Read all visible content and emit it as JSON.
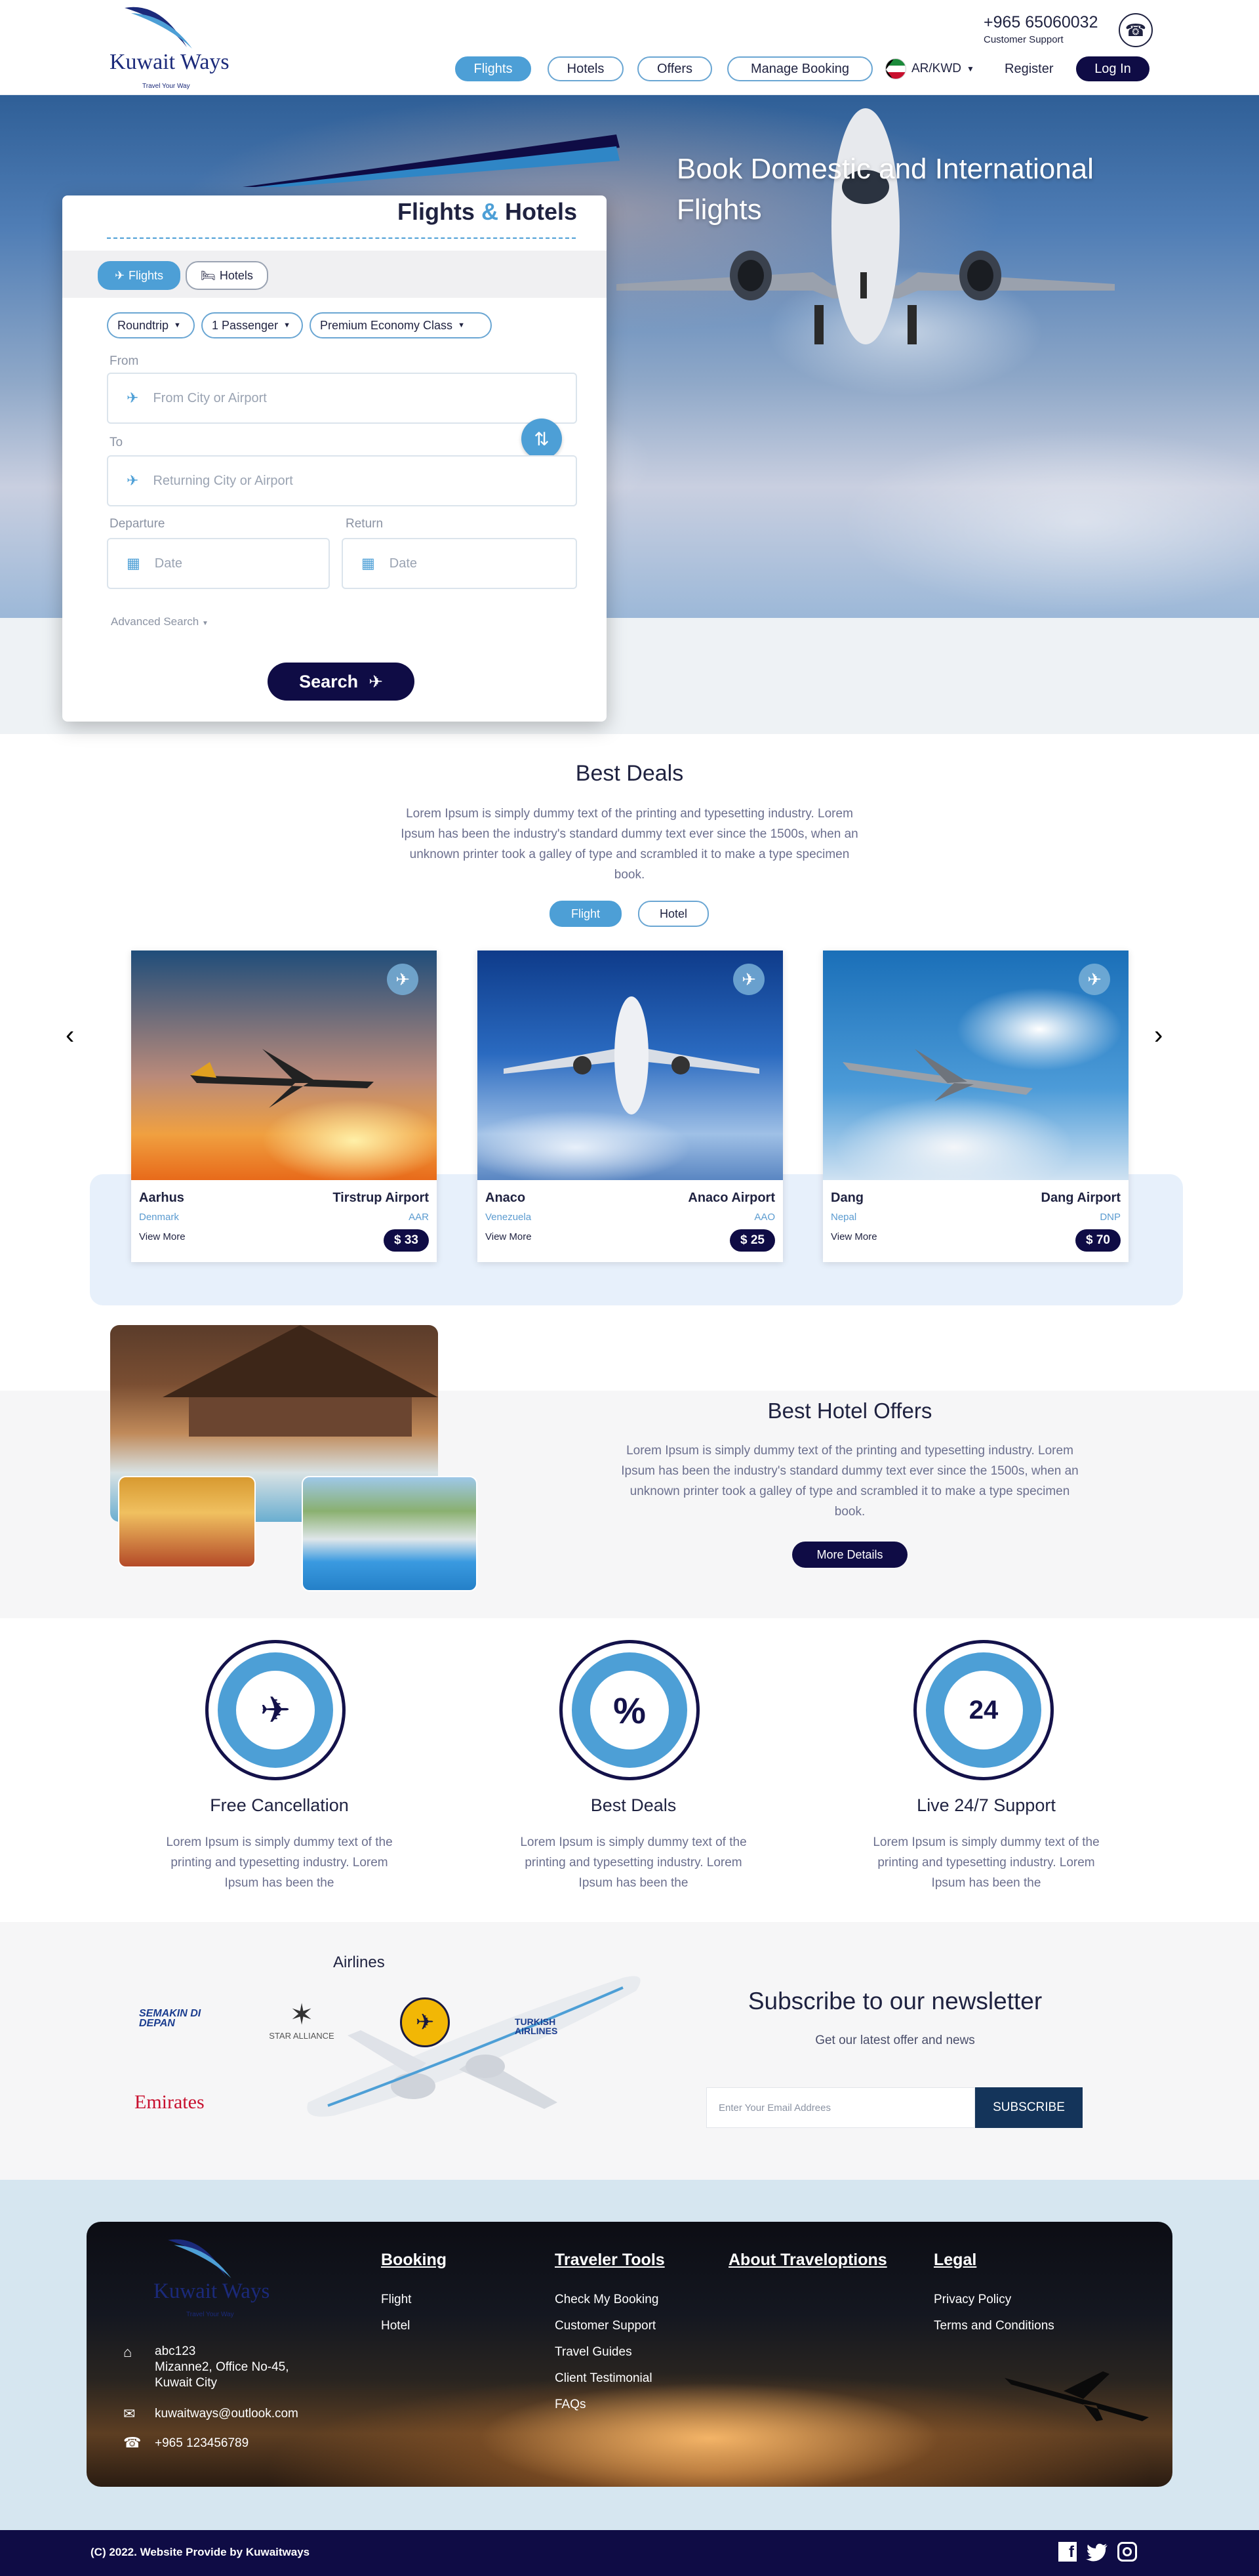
{
  "header": {
    "logo_text": "Kuwait Ways",
    "logo_tagline": "Travel Your Way",
    "phone": "+965 65060032",
    "phone_sub": "Customer Support",
    "nav": [
      "Flights",
      "Hotels",
      "Offers",
      "Manage Booking"
    ],
    "lang": "AR/KWD",
    "register": "Register",
    "login": "Log In"
  },
  "hero": {
    "headline_line1": "Book Domestic and International",
    "headline_line2": "Flights"
  },
  "booking": {
    "title_part1": "Flights",
    "title_amp": "&",
    "title_part2": "Hotels",
    "tabs": [
      "Flights",
      "Hotels"
    ],
    "trip_type": "Roundtrip",
    "passengers": "1 Passenger",
    "cabin": "Premium Economy Class",
    "from_label": "From",
    "from_placeholder": "From City or Airport",
    "to_label": "To",
    "to_placeholder": "Returning City or Airport",
    "departure_label": "Departure",
    "return_label": "Return",
    "date_placeholder": "Date",
    "advanced": "Advanced Search",
    "search": "Search"
  },
  "deals": {
    "title": "Best Deals",
    "desc_l1": "Lorem Ipsum is simply dummy text of the printing and typesetting industry. Lorem",
    "desc_l2": "Ipsum has been the industry's standard dummy text ever since the 1500s, when an",
    "desc_l3": "unknown printer took a galley of type and scrambled it to make a type specimen",
    "desc_l4": "book.",
    "toggle": [
      "Flight",
      "Hotel"
    ],
    "cards": [
      {
        "city": "Aarhus",
        "airport": "Tirstrup Airport",
        "country": "Denmark",
        "code": "AAR",
        "more": "View More",
        "price": "$ 33"
      },
      {
        "city": "Anaco",
        "airport": "Anaco Airport",
        "country": "Venezuela",
        "code": "AAO",
        "more": "View More",
        "price": "$ 25"
      },
      {
        "city": "Dang",
        "airport": "Dang Airport",
        "country": "Nepal",
        "code": "DNP",
        "more": "View More",
        "price": "$ 70"
      }
    ]
  },
  "hotels": {
    "title": "Best Hotel Offers",
    "desc_l1": "Lorem Ipsum is simply dummy text of the printing and typesetting industry. Lorem",
    "desc_l2": "Ipsum has been the industry's standard dummy text ever since the 1500s, when an",
    "desc_l3": "unknown printer took a galley of type and scrambled it to make a type specimen",
    "desc_l4": "book.",
    "button": "More Details"
  },
  "features": [
    {
      "title": "Free Cancellation",
      "l1": "Lorem Ipsum is simply dummy text of the",
      "l2": "printing and typesetting industry. Lorem",
      "l3": "Ipsum has been the"
    },
    {
      "title": "Best Deals",
      "l1": "Lorem Ipsum is simply dummy text of the",
      "l2": "printing and typesetting industry. Lorem",
      "l3": "Ipsum has been the"
    },
    {
      "title": "Live 24/7 Support",
      "l1": "Lorem Ipsum is simply dummy text of the",
      "l2": "printing and typesetting industry. Lorem",
      "l3": "Ipsum has been the"
    }
  ],
  "airlines": {
    "title": "Airlines",
    "logos": [
      "SEMAKIN DI DEPAN",
      "STAR ALLIANCE",
      "Emirates",
      "TURKISH AIRLINES"
    ]
  },
  "newsletter": {
    "title": "Subscribe to our newsletter",
    "sub": "Get our latest offer and news",
    "placeholder": "Enter Your Email Addrees",
    "button": "SUBSCRIBE"
  },
  "footer": {
    "address_l1": "abc123",
    "address_l2": "Mizanne2, Office No-45,",
    "address_l3": "Kuwait City",
    "email": "kuwaitways@outlook.com",
    "phone": "+965 123456789",
    "booking_head": "Booking",
    "booking_links": [
      "Flight",
      "Hotel"
    ],
    "tools_head": "Traveler Tools",
    "tools_links": [
      "Check My Booking",
      "Customer Support",
      "Travel Guides",
      "Client Testimonial",
      "FAQs"
    ],
    "about_head": "About Traveloptions",
    "legal_head": "Legal",
    "legal_links": [
      "Privacy Policy",
      "Terms and Conditions"
    ],
    "copyright": "(C) 2022. Website Provide by Kuwaitways"
  },
  "colors": {
    "navy": "#0f0c45",
    "accent": "#4d9fd6",
    "text": "#1f2240"
  }
}
